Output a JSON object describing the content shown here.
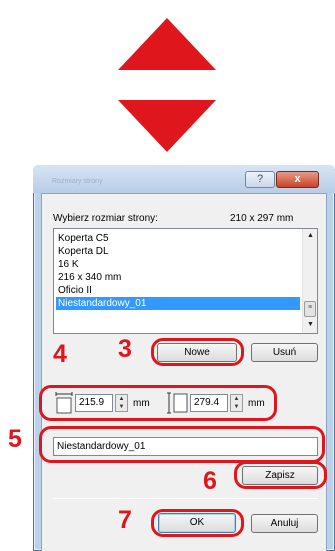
{
  "dialog": {
    "select_size_label": "Wybierz rozmiar strony:",
    "size_value": "210 x 297 mm",
    "paper_sizes": [
      "Koperta C5",
      "Koperta DL",
      "16 K",
      "216 x 340 mm",
      "Oficio II",
      "Niestandardowy_01"
    ],
    "selected_index": 5,
    "new_button": "Nowe",
    "delete_button": "Usuń",
    "width_value": "215.9",
    "height_value": "279.4",
    "unit": "mm",
    "name_value": "Niestandardowy_01",
    "save_button": "Zapisz",
    "ok_button": "OK",
    "cancel_button": "Anuluj"
  },
  "titlebar": {
    "title": "Rozmiary strony",
    "help_label": "?",
    "close_label": "x"
  },
  "callouts": [
    "3",
    "4",
    "5",
    "6",
    "7"
  ],
  "accent_color": "#e0161d",
  "selection_color": "#3399ff"
}
